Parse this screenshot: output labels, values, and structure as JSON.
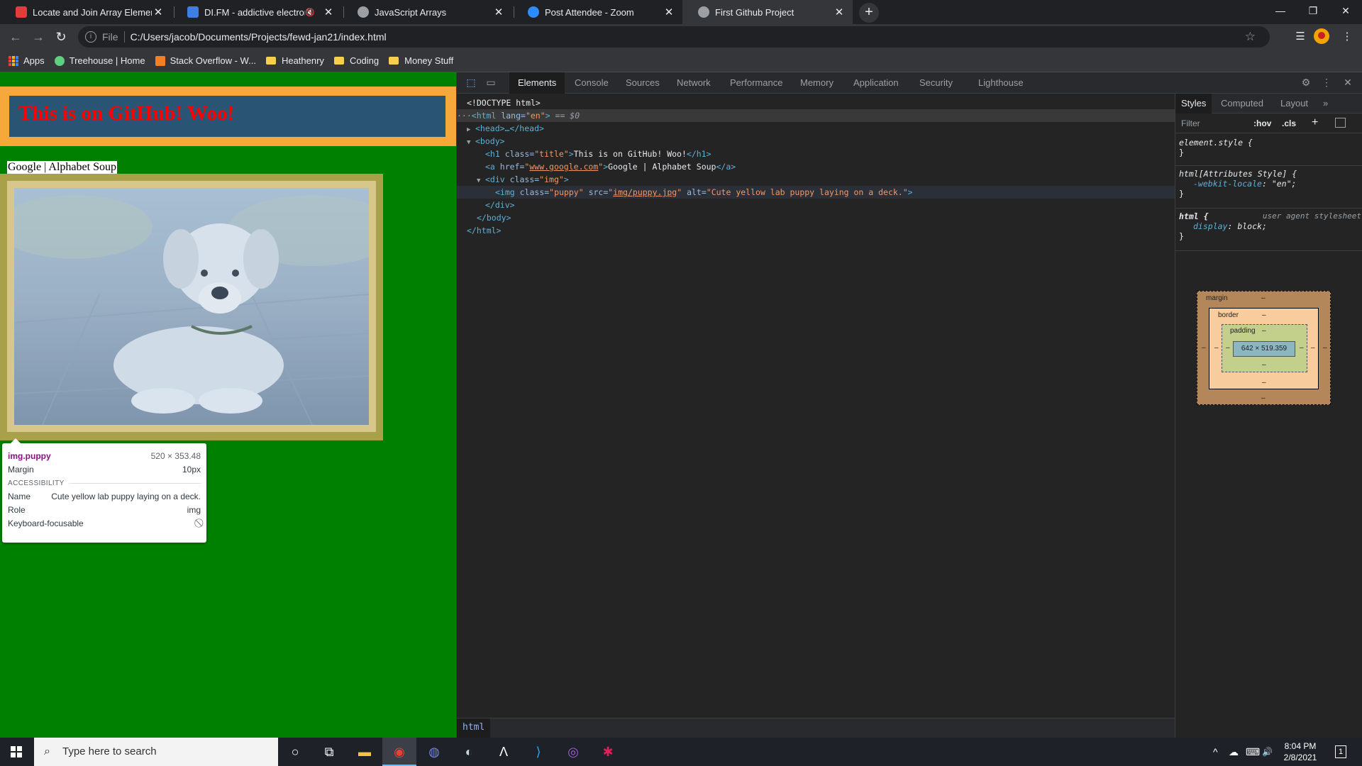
{
  "browser": {
    "tabs": [
      {
        "title": "Locate and Join Array Elements |",
        "active": false,
        "favicon_color": "#e33c3c"
      },
      {
        "title": "DI.FM - addictive electronic",
        "active": false,
        "favicon_color": "#3d7de4",
        "muted": "🔇"
      },
      {
        "title": "JavaScript Arrays",
        "active": false,
        "favicon_color": "#9aa0a6"
      },
      {
        "title": "Post Attendee - Zoom",
        "active": false,
        "favicon_color": "#2d8cff"
      },
      {
        "title": "First Github Project",
        "active": true,
        "favicon_color": "#9aa0a6"
      }
    ],
    "tab_close": "✕",
    "new_tab": "+",
    "window_controls": {
      "minimize": "—",
      "restore": "❐",
      "close": "✕"
    },
    "nav": {
      "back": "←",
      "forward": "→",
      "reload": "↻"
    },
    "omnibox": {
      "info": "i",
      "scheme": "File",
      "url": "C:/Users/jacob/Documents/Projects/fewd-jan21/index.html",
      "star": "☆"
    },
    "toolbar_icons": {
      "reading_list": "☰",
      "menu": "⋮"
    },
    "bookmarks": [
      {
        "label": "Apps",
        "kind": "apps"
      },
      {
        "label": "Treehouse | Home",
        "kind": "site",
        "color": "#5fcf80"
      },
      {
        "label": "Stack Overflow - W...",
        "kind": "site",
        "color": "#f48024"
      },
      {
        "label": "Heathenry",
        "kind": "folder"
      },
      {
        "label": "Coding",
        "kind": "folder"
      },
      {
        "label": "Money Stuff",
        "kind": "folder"
      }
    ]
  },
  "page": {
    "title": "This is on GitHub! Woo!",
    "link_text": "Google | Alphabet Soup",
    "img_alt": "Cute yellow lab puppy laying on a deck."
  },
  "tooltip": {
    "selector": "img.puppy",
    "size": "520 × 353.48",
    "margin_label": "Margin",
    "margin_value": "10px",
    "section": "ACCESSIBILITY",
    "name_label": "Name",
    "name_value": "Cute yellow lab puppy laying on a deck.",
    "role_label": "Role",
    "role_value": "img",
    "focus_label": "Keyboard-focusable",
    "focus_value": "⃠"
  },
  "devtools": {
    "tabs": [
      "Elements",
      "Console",
      "Sources",
      "Network",
      "Performance",
      "Memory",
      "Application",
      "Security",
      "Lighthouse"
    ],
    "active_tab": "Elements",
    "icons": {
      "inspect": "⬚",
      "device": "▭",
      "settings": "⚙",
      "menu": "⋮",
      "close": "✕"
    },
    "dom": {
      "doctype": "<!DOCTYPE html>",
      "html_open_tag": "<html",
      "html_lang_attr": " lang=",
      "html_lang_val": "\"en\"",
      "html_close_bracket": ">",
      "html_selected_marker": " == $0",
      "head": "<head>…</head>",
      "body_open": "<body>",
      "h1_open": "<h1",
      "h1_class_attr": " class=",
      "h1_class_val": "\"title\"",
      "h1_text": "This is on GitHub! Woo!",
      "h1_close": "</h1>",
      "a_open": "<a",
      "a_href_attr": " href=",
      "a_href_val": "www.google.com",
      "a_text": "Google | Alphabet Soup",
      "a_close": "</a>",
      "div_open": "<div",
      "div_class_attr": " class=",
      "div_class_val": "\"img\"",
      "img_open": "<img",
      "img_class_attr": " class=",
      "img_class_val": "\"puppy\"",
      "img_src_attr": " src=",
      "img_src_val": "img/puppy.jpg",
      "img_alt_attr": " alt=",
      "img_alt_val": "\"Cute yellow lab puppy laying on a deck.\"",
      "div_close": "</div>",
      "body_close": "</body>",
      "html_close": "</html>",
      "gt": ">",
      "quote": "\"",
      "ellipsis": "···"
    },
    "breadcrumb": "html",
    "styles": {
      "tabs": [
        "Styles",
        "Computed",
        "Layout"
      ],
      "more": "»",
      "filter_placeholder": "Filter",
      "hov": ":hov",
      "cls": ".cls",
      "plus": "+",
      "rule1_selector": "element.style {",
      "rule1_close": "}",
      "rule2_selector": "html[Attributes Style] {",
      "rule2_prop": "-webkit-locale",
      "rule2_val": "\"en\";",
      "rule2_close": "}",
      "rule3_selector": "html {",
      "rule3_source": "user agent stylesheet",
      "rule3_prop": "display",
      "rule3_val": "block;",
      "rule3_close": "}",
      "colon": ": "
    },
    "box_model": {
      "margin_label": "margin",
      "border_label": "border",
      "padding_label": "padding",
      "content": "642 × 519.359",
      "dash": "–"
    }
  },
  "taskbar": {
    "search_placeholder": "Type here to search",
    "clock_time": "8:04 PM",
    "clock_date": "2/8/2021",
    "apps": [
      {
        "name": "cortana",
        "glyph": "○"
      },
      {
        "name": "task-view",
        "glyph": "⧉"
      },
      {
        "name": "file-explorer",
        "glyph": "▬"
      },
      {
        "name": "chrome",
        "glyph": "◉"
      },
      {
        "name": "discord",
        "glyph": "◍"
      },
      {
        "name": "steam",
        "glyph": "◐"
      },
      {
        "name": "app-a",
        "glyph": "Λ"
      },
      {
        "name": "vscode",
        "glyph": "⟩"
      },
      {
        "name": "app-purple",
        "glyph": "◎"
      },
      {
        "name": "slack",
        "glyph": "✱"
      }
    ],
    "tray": {
      "chevron": "^",
      "cloud": "☁",
      "network": "⌨",
      "volume": "🔊",
      "notifications": "1"
    }
  }
}
